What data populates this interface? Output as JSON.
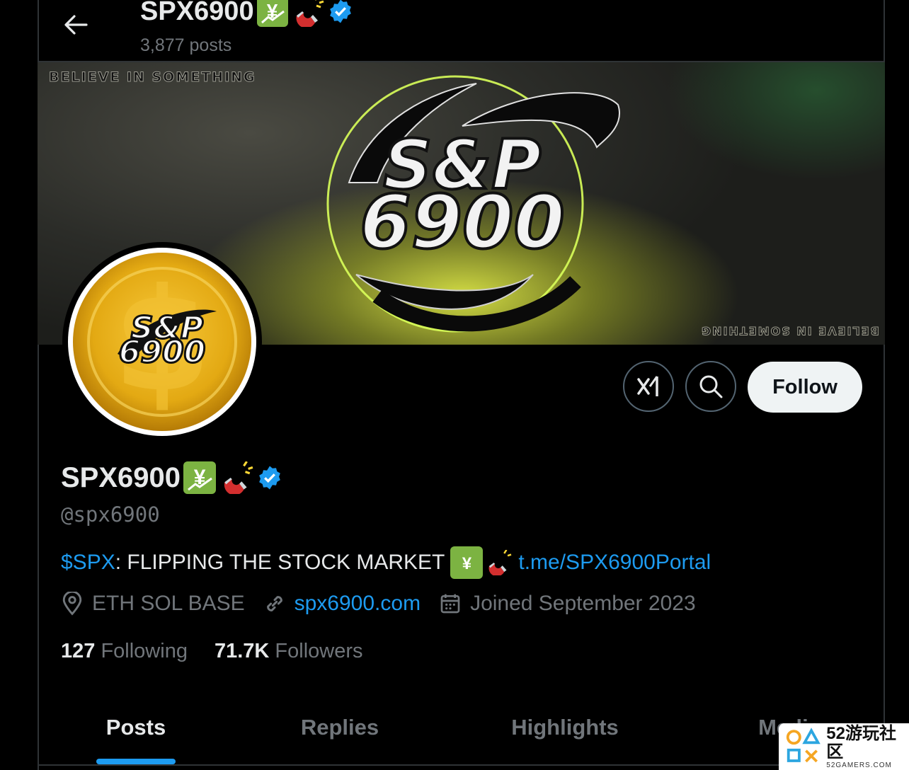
{
  "header": {
    "display_name": "SPX6900",
    "posts_count": "3,877 posts"
  },
  "banner": {
    "tagline_top": "BELIEVE IN SOMETHING",
    "tagline_bottom": "BELIEVE IN SOMETHING",
    "logo_line1": "S&P",
    "logo_line2": "6900"
  },
  "avatar": {
    "logo_line1": "S&P",
    "logo_line2": "6900"
  },
  "actions": {
    "grok_icon": "grok-icon",
    "search_icon": "search-icon",
    "follow_label": "Follow"
  },
  "profile": {
    "display_name": "SPX6900",
    "name_emojis": [
      "chart-yen-icon",
      "magnet-icon"
    ],
    "verified": true,
    "handle": "@spx6900",
    "bio_cashtag": "$SPX",
    "bio_text": ": FLIPPING THE STOCK MARKET",
    "bio_link": "t.me/SPX6900Portal",
    "location": "ETH SOL BASE",
    "website": "spx6900.com",
    "joined": "Joined September 2023",
    "following_count": "127",
    "following_label": "Following",
    "followers_count": "71.7K",
    "followers_label": "Followers"
  },
  "tabs": [
    {
      "label": "Posts",
      "active": true
    },
    {
      "label": "Replies",
      "active": false
    },
    {
      "label": "Highlights",
      "active": false
    },
    {
      "label": "Media",
      "active": false
    }
  ],
  "watermark": {
    "main": "52游玩社区",
    "sub": "52GAMERS.COM"
  },
  "colors": {
    "accent": "#1d9bf0",
    "muted": "#71767b",
    "text": "#e7e9ea",
    "border": "#2f3336",
    "gold": "#e9b423"
  }
}
